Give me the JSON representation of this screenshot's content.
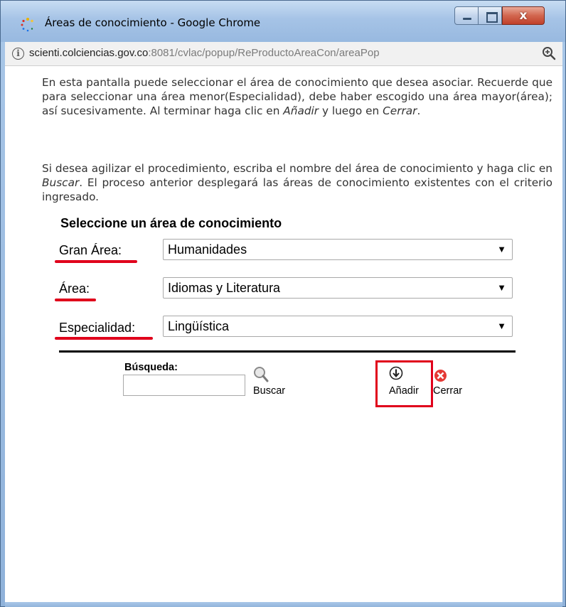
{
  "window": {
    "title": "Áreas de conocimiento - Google Chrome",
    "close_glyph": "x",
    "url_host": "scienti.colciencias.gov.co",
    "url_rest": ":8081/cvlac/popup/ReProductoAreaCon/areaPop"
  },
  "content": {
    "p1_a": "En esta pantalla puede seleccionar el área de conocimiento que desea asociar. Recuerde que para seleccionar una área menor(Especialidad), debe haber escogido una área mayor(área); así sucesivamente. Al terminar haga clic en ",
    "p1_add": "Añadir",
    "p1_b": " y luego en ",
    "p1_close": "Cerrar",
    "p1_c": ".",
    "p2_a": "Si desea agilizar el procedimiento, escriba el nombre del área de conocimiento y haga clic en ",
    "p2_search": "Buscar",
    "p2_b": ". El proceso anterior desplegará las áreas de conocimiento existentes con el criterio ingresado."
  },
  "form": {
    "title": "Seleccione un área de conocimiento",
    "gran_area_label": "Gran Área",
    "gran_area_value": "Humanidades",
    "area_label": "Área",
    "area_value": "Idiomas y Literatura",
    "especialidad_label": "Especialidad",
    "especialidad_value": "Lingüística",
    "colon": ":",
    "arrow": "▼"
  },
  "search": {
    "label": "Búsqueda:",
    "input_value": "",
    "buscar": "Buscar",
    "anadir": "Añadir",
    "cerrar": "Cerrar"
  },
  "colors": {
    "highlight": "#e0001b",
    "titlebar": "#a5c3e6"
  }
}
